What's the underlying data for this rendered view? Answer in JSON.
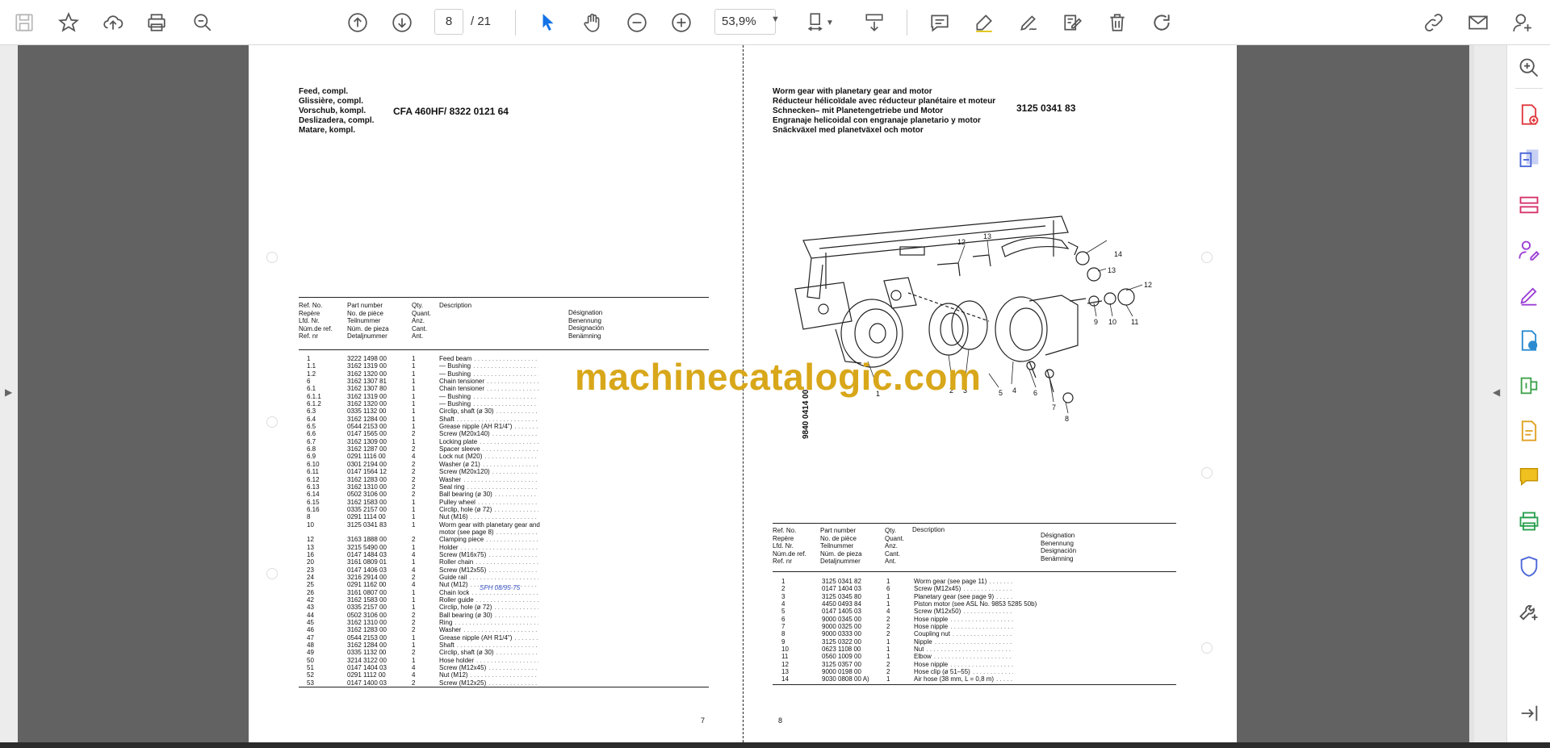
{
  "toolbar": {
    "current_page": "8",
    "total_pages": "/ 21",
    "zoom": "53,9%"
  },
  "left_page": {
    "header_lines": [
      "Feed, compl.",
      "Glissière, compl.",
      "Vorschub, kompl.",
      "Deslizadera, compl.",
      "Matare, kompl."
    ],
    "title": "CFA 460HF/ 8322 0121 64",
    "columns": {
      "ref": [
        "Ref. No.",
        "Repère",
        "Lfd. Nr.",
        "Núm.de ref.",
        "Ref. nr"
      ],
      "part": [
        "Part number",
        "No. de pièce",
        "Teilnummer",
        "Núm. de pieza",
        "Detaljnummer"
      ],
      "qty": [
        "Qty.",
        "Quant.",
        "Anz.",
        "Cant.",
        "Ant."
      ],
      "desc": [
        "Description"
      ],
      "desig": [
        "Désignation",
        "Benennung",
        "Designación",
        "Benämning"
      ]
    },
    "rows": [
      [
        "1",
        "3222 1498 00",
        "1",
        "Feed beam"
      ],
      [
        "1.1",
        "3162 1319 00",
        "1",
        "— Bushing"
      ],
      [
        "1.2",
        "3162 1320 00",
        "1",
        "— Bushing"
      ],
      [
        "6",
        "3162 1307 81",
        "1",
        "Chain tensioner"
      ],
      [
        "6.1",
        "3162 1307 80",
        "1",
        "Chain tensioner"
      ],
      [
        "6.1.1",
        "3162 1319 00",
        "1",
        "— Bushing"
      ],
      [
        "6.1.2",
        "3162 1320 00",
        "1",
        "— Bushing"
      ],
      [
        "6.3",
        "0335 1132 00",
        "1",
        "Circlip, shaft (ø 30)"
      ],
      [
        "6.4",
        "3162 1284 00",
        "1",
        "Shaft"
      ],
      [
        "6.5",
        "0544 2153 00",
        "1",
        "Grease nipple (AH R1/4\")"
      ],
      [
        "6.6",
        "0147 1565 00",
        "2",
        "Screw (M20x140)"
      ],
      [
        "6.7",
        "3162 1309 00",
        "1",
        "Locking plate"
      ],
      [
        "6.8",
        "3162 1287 00",
        "2",
        "Spacer sleeve"
      ],
      [
        "6.9",
        "0291 1116 00",
        "4",
        "Lock nut (M20)"
      ],
      [
        "6.10",
        "0301 2194 00",
        "2",
        "Washer (ø 21)"
      ],
      [
        "6.11",
        "0147 1564 12",
        "2",
        "Screw (M20x120)"
      ],
      [
        "6.12",
        "3162 1283 00",
        "2",
        "Washer"
      ],
      [
        "6.13",
        "3162 1310 00",
        "2",
        "Seal ring"
      ],
      [
        "6.14",
        "0502 3106 00",
        "2",
        "Ball bearing (ø 30)"
      ],
      [
        "6.15",
        "3162 1583 00",
        "1",
        "Pulley wheel"
      ],
      [
        "6.16",
        "0335 2157 00",
        "1",
        "Circlip, hole (ø 72)"
      ],
      [
        "8",
        "0291 1114 00",
        "1",
        "Nut (M16)"
      ],
      [
        "10",
        "3125 0341 83",
        "1",
        "Worm gear with planetary gear and"
      ],
      [
        "",
        "",
        "",
        "motor (see page 8)"
      ],
      [
        "12",
        "3163 1888 00",
        "2",
        "Clamping piece"
      ],
      [
        "13",
        "3215 5490 00",
        "1",
        "Holder"
      ],
      [
        "16",
        "0147 1484 03",
        "4",
        "Screw (M16x75)"
      ],
      [
        "20",
        "3161 0809 01",
        "1",
        "Roller chain"
      ],
      [
        "23",
        "0147 1406 03",
        "4",
        "Screw (M12x55)"
      ],
      [
        "24",
        "3216 2914 00",
        "2",
        "Guide rail"
      ],
      [
        "25",
        "0291 1162 00",
        "4",
        "Nut (M12)"
      ],
      [
        "26",
        "3161 0807 00",
        "1",
        "Chain lock"
      ],
      [
        "42",
        "3162 1583 00",
        "1",
        "Roller guide"
      ],
      [
        "43",
        "0335 2157 00",
        "1",
        "Circlip, hole (ø 72)"
      ],
      [
        "44",
        "0502 3106 00",
        "2",
        "Ball bearing (ø 30)"
      ],
      [
        "45",
        "3162 1310 00",
        "2",
        "Ring"
      ],
      [
        "46",
        "3162 1283 00",
        "2",
        "Washer"
      ],
      [
        "47",
        "0544 2153 00",
        "1",
        "Grease nipple (AH R1/4\")"
      ],
      [
        "48",
        "3162 1284 00",
        "1",
        "Shaft"
      ],
      [
        "49",
        "0335 1132 00",
        "2",
        "Circlip, shaft (ø 30)"
      ],
      [
        "50",
        "3214 3122 00",
        "1",
        "Hose holder"
      ],
      [
        "51",
        "0147 1404 03",
        "4",
        "Screw (M12x45)"
      ],
      [
        "52",
        "0291 1112 00",
        "4",
        "Nut (M12)"
      ],
      [
        "53",
        "0147 1400 03",
        "2",
        "Screw (M12x25)"
      ]
    ],
    "page_number": "7"
  },
  "right_page": {
    "header_lines": [
      "Worm gear with planetary gear and motor",
      "Réducteur hélicoïdale avec réducteur planétaire et moteur",
      "Schnecken– mit Planetengetriebe und Motor",
      "Engranaje helicoidal con engranaje planetario y motor",
      "Snäckväxel med planetväxel och motor"
    ],
    "title": "3125 0341 83",
    "doc_code": "9840 0414 00",
    "columns": {
      "ref": [
        "Ref. No.",
        "Repère",
        "Lfd. Nr.",
        "Núm.de ref.",
        "Ref. nr"
      ],
      "part": [
        "Part number",
        "No. de pièce",
        "Teilnummer",
        "Núm. de pieza",
        "Detaljnummer"
      ],
      "qty": [
        "Qty.",
        "Quant.",
        "Anz.",
        "Cant.",
        "Ant."
      ],
      "desc": [
        "Description"
      ],
      "desig": [
        "Désignation",
        "Benennung",
        "Designación",
        "Benämning"
      ]
    },
    "rows": [
      [
        "1",
        "3125 0341 82",
        "1",
        "Worm gear (see page 11)"
      ],
      [
        "2",
        "0147 1404 03",
        "6",
        "Screw (M12x45)"
      ],
      [
        "3",
        "3125 0345 80",
        "1",
        "Planetary gear (see page 9)"
      ],
      [
        "4",
        "4450 0493 84",
        "1",
        "Piston motor (see ASL No. 9853 5285 50b)"
      ],
      [
        "5",
        "0147 1405 03",
        "4",
        "Screw (M12x50)"
      ],
      [
        "6",
        "9000 0345 00",
        "2",
        "Hose nipple"
      ],
      [
        "7",
        "9000 0325 00",
        "2",
        "Hose nipple"
      ],
      [
        "8",
        "9000 0333 00",
        "2",
        "Coupling nut"
      ],
      [
        "9",
        "3125 0322 00",
        "1",
        "Nipple"
      ],
      [
        "10",
        "0623 1108 00",
        "1",
        "Nut"
      ],
      [
        "11",
        "0560 1009 00",
        "1",
        "Elbow"
      ],
      [
        "12",
        "3125 0357 00",
        "2",
        "Hose nipple"
      ],
      [
        "13",
        "9000 0198 00",
        "2",
        "Hose clip (ø 51–55)"
      ],
      [
        "14",
        "9030 0808 00 A)",
        "1",
        "Air hose (38 mm, L = 0,8 m)"
      ]
    ],
    "callouts": [
      "1",
      "2",
      "3",
      "4",
      "5",
      "6",
      "7",
      "8",
      "9",
      "10",
      "11",
      "12",
      "12",
      "13",
      "13",
      "14"
    ],
    "page_number": "8"
  },
  "watermark": "machinecatalogic.com",
  "stamp_text": "SPH 08/95-75"
}
